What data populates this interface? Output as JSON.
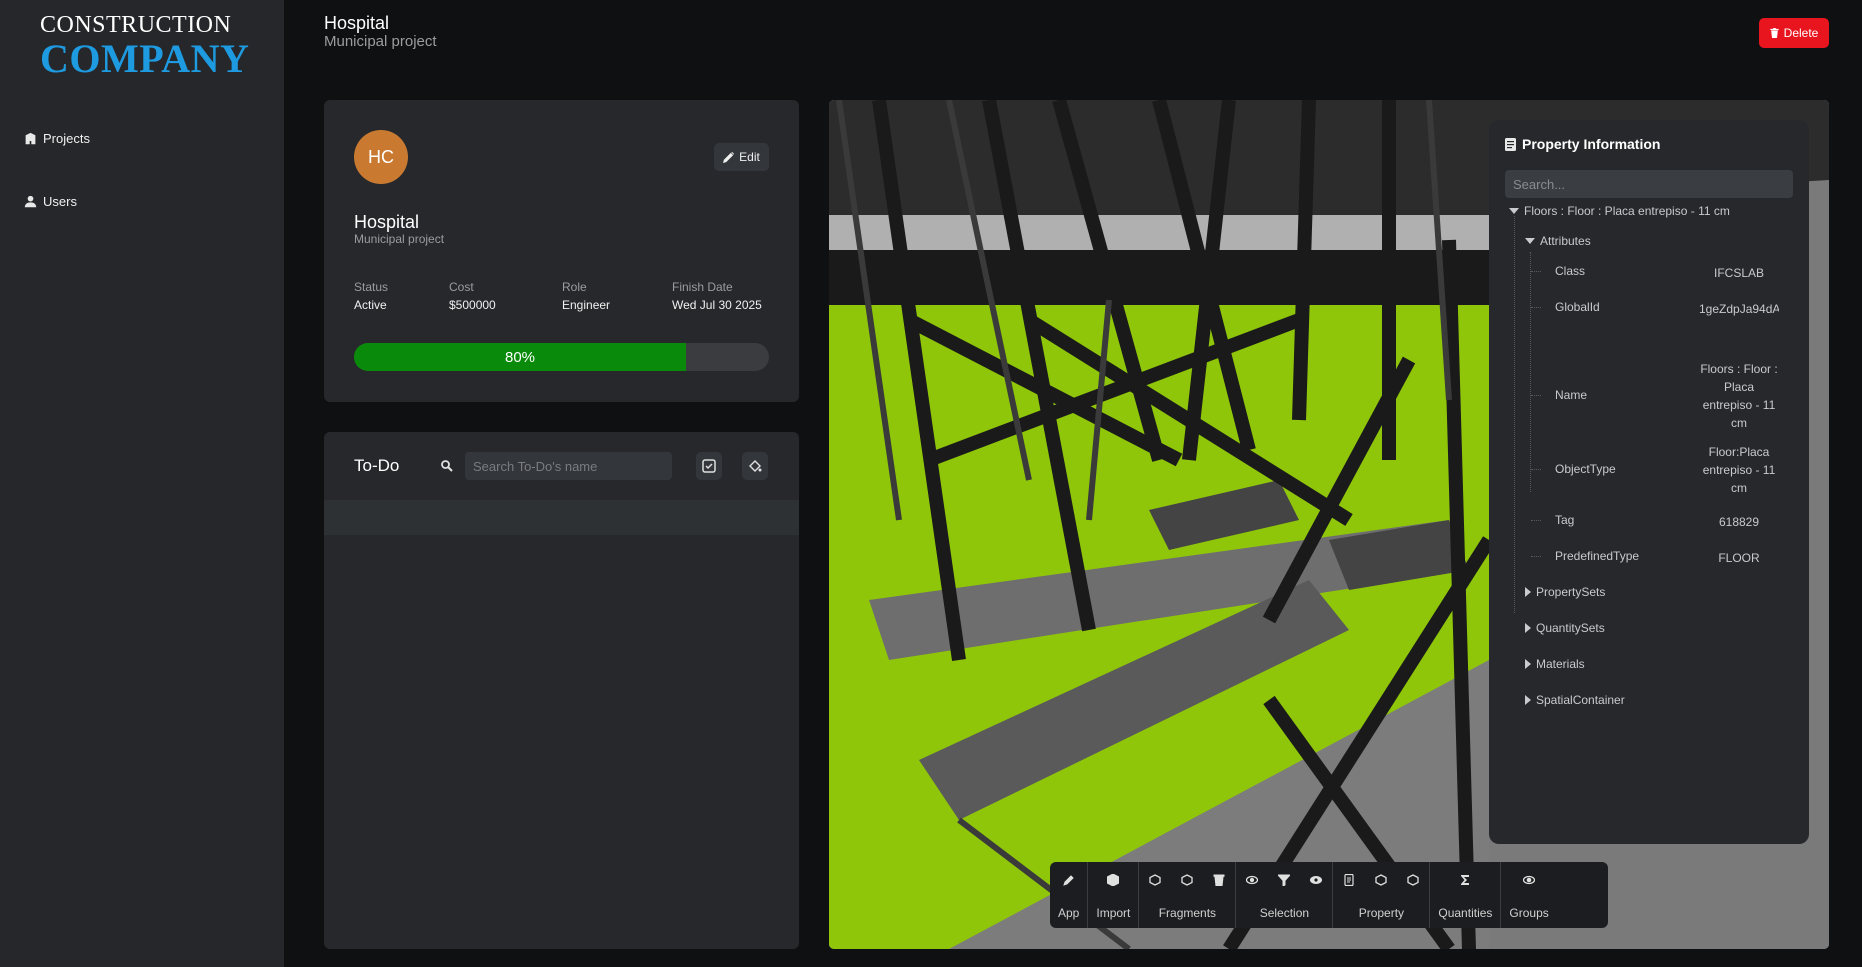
{
  "sidebar": {
    "logo_top": "CONSTRUCTION",
    "logo_bottom": "COMPANY",
    "items": [
      {
        "label": "Projects",
        "icon": "building-icon"
      },
      {
        "label": "Users",
        "icon": "person-icon"
      }
    ]
  },
  "header": {
    "title": "Hospital",
    "subtitle": "Municipal project",
    "delete_label": "Delete"
  },
  "project_card": {
    "initials": "HC",
    "edit_label": "Edit",
    "name": "Hospital",
    "description": "Municipal project",
    "stats": [
      {
        "label": "Status",
        "value": "Active"
      },
      {
        "label": "Cost",
        "value": "$500000"
      },
      {
        "label": "Role",
        "value": "Engineer"
      },
      {
        "label": "Finish Date",
        "value": "Wed Jul 30 2025"
      }
    ],
    "progress_label": "80%",
    "progress_value": 0.8
  },
  "todo": {
    "title": "To-Do",
    "search_placeholder": "Search To-Do's name"
  },
  "property_panel": {
    "title": "Property Information",
    "search_placeholder": "Search...",
    "root": "Floors : Floor : Placa entrepiso - 11 cm",
    "attributes_label": "Attributes",
    "attributes": [
      {
        "key": "Class",
        "value": "IFCSLAB"
      },
      {
        "key": "GlobalId",
        "value": "1geZdpJa94dA"
      },
      {
        "key": "Name",
        "value": "Floors : Floor : Placa entrepiso - 11 cm"
      },
      {
        "key": "ObjectType",
        "value": "Floor:Placa entrepiso - 11 cm"
      },
      {
        "key": "Tag",
        "value": "618829"
      },
      {
        "key": "PredefinedType",
        "value": "FLOOR"
      }
    ],
    "collapsed": [
      "PropertySets",
      "QuantitySets",
      "Materials",
      "SpatialContainer"
    ]
  },
  "toolbar": {
    "groups": [
      {
        "label": "App",
        "icons": [
          "pen-icon"
        ]
      },
      {
        "label": "Import",
        "icons": [
          "cube-icon"
        ]
      },
      {
        "label": "Fragments",
        "icons": [
          "fragment-settings-icon",
          "fragment-export-icon",
          "trash-icon"
        ]
      },
      {
        "label": "Selection",
        "icons": [
          "eye-icon",
          "filter-icon",
          "eye-focus-icon"
        ]
      },
      {
        "label": "Property",
        "icons": [
          "document-icon",
          "cube-settings-icon",
          "cube-export-icon"
        ]
      },
      {
        "label": "Quantities",
        "icons": [
          "sigma-icon"
        ]
      },
      {
        "label": "Groups",
        "icons": [
          "eye-group-icon"
        ]
      }
    ]
  },
  "colors": {
    "accent_blue": "#1e9be0",
    "delete_red": "#e8141e",
    "progress_green": "#0a8a0a",
    "avatar_orange": "#c97a30",
    "slab_green": "#8fc60a"
  }
}
